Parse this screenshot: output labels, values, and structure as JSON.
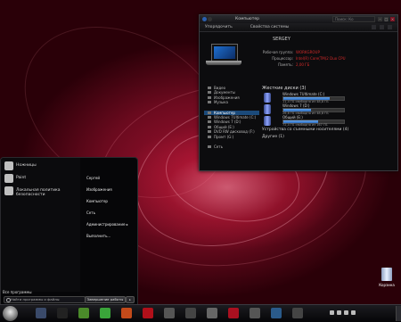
{
  "explorer": {
    "title": "Компьютер",
    "search_placeholder": "Поиск: Ко",
    "menu": {
      "organize": "Упорядочить",
      "properties": "Свойства системы"
    },
    "computer_name": "SERGEY",
    "info": [
      {
        "label": "Рабочая группа:",
        "value": "WORKGROUP"
      },
      {
        "label": "Процессор:",
        "value": "Intel(R) Core(TM)2 Duo CPU"
      },
      {
        "label": "Память:",
        "value": "2,00 ГБ"
      }
    ],
    "nav": {
      "libraries": [
        "Видео",
        "Документы",
        "Изображения",
        "Музыка"
      ],
      "computer": "Компьютер",
      "drives": [
        "Windows 7Ultimate (C:)",
        "Windows 7 (D:)",
        "Общий (E:)",
        "DVD RW дисковод (F:)",
        "Промт (G:)"
      ],
      "network": "Сеть"
    },
    "hdd_header": "Жесткие диски (3)",
    "drives": [
      {
        "name": "Windows 7Ultimate (C:)",
        "free": "11,4 ГБ свободно из 48,8 ГБ",
        "used_pct": 77
      },
      {
        "name": "Windows 7 (D:)",
        "free": "26,8 ГБ свободно из 48,8 ГБ",
        "used_pct": 45
      },
      {
        "name": "Общий (E:)",
        "free": "72,4 ГБ свободно из 167 ГБ",
        "used_pct": 57
      }
    ],
    "removable_header": "Устройства со съемными носителями (4)",
    "other_header": "Другие (1)"
  },
  "startmenu": {
    "pinned": [
      "Ножницы",
      "Paint",
      "Локальная политика безопасности"
    ],
    "all_programs": "Все программы",
    "search_placeholder": "Найти программы и файлы",
    "right": [
      "Сергей",
      "Изображения",
      "Компьютер",
      "Сеть",
      "Администрирование",
      "Выполнить..."
    ],
    "admin_arrow": "▸",
    "shutdown": "Завершение работы",
    "shutdown_arrow": "▸"
  },
  "desktop": {
    "recycle_bin": "Корзина"
  },
  "taskbar": {
    "clock": "",
    "icons": [
      {
        "name": "explorer-taskbar-icon",
        "color": "#3a4a6a"
      },
      {
        "name": "media-player-taskbar-icon",
        "color": "#222"
      },
      {
        "name": "chrome-taskbar-icon",
        "color": "#4a8a2a"
      },
      {
        "name": "utorrent-taskbar-icon",
        "color": "#3aa43a"
      },
      {
        "name": "firefox-taskbar-icon",
        "color": "#c24a1a"
      },
      {
        "name": "opera-taskbar-icon",
        "color": "#b0101a"
      },
      {
        "name": "app-taskbar-icon-1",
        "color": "#555"
      },
      {
        "name": "app-taskbar-icon-2",
        "color": "#444"
      },
      {
        "name": "app-taskbar-icon-3",
        "color": "#666"
      },
      {
        "name": "res-taskbar-icon",
        "color": "#aa1020"
      },
      {
        "name": "app-taskbar-icon-4",
        "color": "#555"
      },
      {
        "name": "app-taskbar-icon-5",
        "color": "#2a5a8a"
      },
      {
        "name": "app-taskbar-icon-6",
        "color": "#444"
      }
    ]
  }
}
